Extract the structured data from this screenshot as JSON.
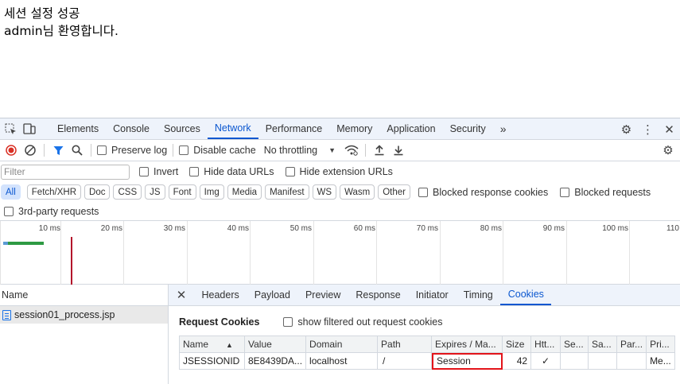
{
  "page": {
    "line1": "세션 설정 성공",
    "line2": "admin님 환영합니다."
  },
  "devtools": {
    "main_tabs": [
      "Elements",
      "Console",
      "Sources",
      "Network",
      "Performance",
      "Memory",
      "Application",
      "Security"
    ],
    "active_main_tab": "Network",
    "toolbar": {
      "preserve_log": "Preserve log",
      "disable_cache": "Disable cache",
      "throttling": "No throttling"
    },
    "filter": {
      "placeholder": "Filter",
      "invert": "Invert",
      "hide_data_urls": "Hide data URLs",
      "hide_extension_urls": "Hide extension URLs"
    },
    "type_chips": [
      "All",
      "Fetch/XHR",
      "Doc",
      "CSS",
      "JS",
      "Font",
      "Img",
      "Media",
      "Manifest",
      "WS",
      "Wasm",
      "Other"
    ],
    "blocked_response_cookies": "Blocked response cookies",
    "blocked_requests": "Blocked requests",
    "third_party_requests": "3rd-party requests",
    "timeline_labels": [
      "10 ms",
      "20 ms",
      "30 ms",
      "40 ms",
      "50 ms",
      "60 ms",
      "70 ms",
      "80 ms",
      "90 ms",
      "100 ms",
      "110"
    ],
    "requests_header": "Name",
    "requests": [
      "session01_process.jsp"
    ],
    "detail_tabs": [
      "Headers",
      "Payload",
      "Preview",
      "Response",
      "Initiator",
      "Timing",
      "Cookies"
    ],
    "active_detail_tab": "Cookies",
    "request_cookies_title": "Request Cookies",
    "show_filtered": "show filtered out request cookies",
    "cookie_columns": [
      "Name",
      "Value",
      "Domain",
      "Path",
      "Expires / Ma...",
      "Size",
      "Htt...",
      "Se...",
      "Sa...",
      "Par...",
      "Pri..."
    ],
    "cookies": [
      {
        "name": "JSESSIONID",
        "value": "8E8439DA...",
        "domain": "localhost",
        "path": "/",
        "expires": "Session",
        "size": "42",
        "httponly": "✓",
        "secure": "",
        "samesite": "",
        "partition": "",
        "priority": "Me..."
      }
    ]
  }
}
